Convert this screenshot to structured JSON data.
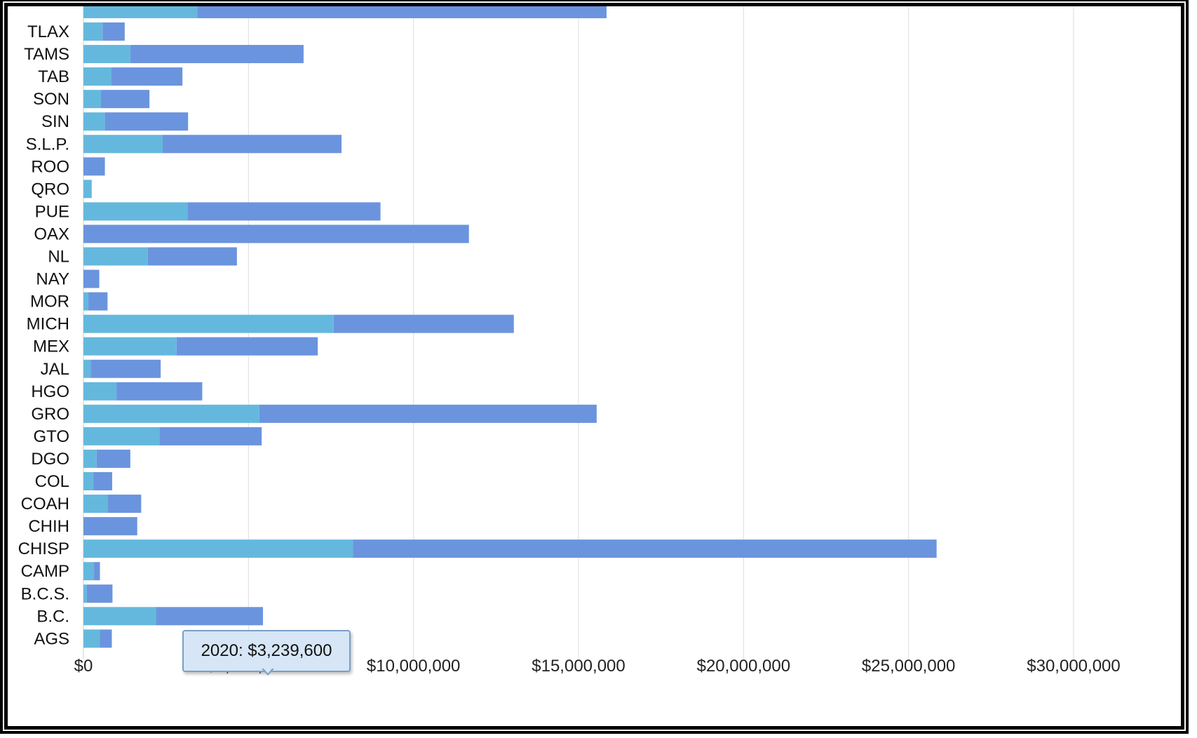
{
  "chart_data": {
    "type": "bar",
    "orientation": "horizontal",
    "stacked": true,
    "categories": [
      "TLAX",
      "TAMS",
      "TAB",
      "SON",
      "SIN",
      "S.L.P.",
      "ROO",
      "QRO",
      "PUE",
      "OAX",
      "NL",
      "NAY",
      "MOR",
      "MICH",
      "MEX",
      "JAL",
      "HGO",
      "GRO",
      "GTO",
      "DGO",
      "COL",
      "COAH",
      "CHIH",
      "CHISP",
      "CAMP",
      "B.C.S.",
      "B.C.",
      "AGS"
    ],
    "partial_top_category_value": 15850000,
    "partial_top_segment_value": 3450000,
    "series": [
      {
        "values": [
          580000,
          1420000,
          850000,
          530000,
          650000,
          2400000,
          0,
          250000,
          3150000,
          0,
          1950000,
          0,
          150000,
          7580000,
          2820000,
          220000,
          1000000,
          5330000,
          2300000,
          400000,
          300000,
          730000,
          0,
          8170000,
          320000,
          100000,
          2200000,
          500000
        ],
        "color": "#65b8dd"
      },
      {
        "values": [
          670000,
          5250000,
          2150000,
          1470000,
          2520000,
          5420000,
          650000,
          0,
          5850000,
          11680000,
          2700000,
          480000,
          580000,
          5460000,
          4280000,
          2120000,
          2600000,
          10220000,
          3100000,
          1020000,
          570000,
          1020000,
          1630000,
          17680000,
          180000,
          780000,
          3239600,
          360000
        ],
        "color": "#6b94de"
      }
    ],
    "xlim": [
      0,
      30000000
    ],
    "xticks": [
      "$0",
      "$5,000,000",
      "$10,000,000",
      "$15,000,000",
      "$20,000,000",
      "$25,000,000",
      "$30,000,000"
    ],
    "tick_values": [
      0,
      5000000,
      10000000,
      15000000,
      20000000,
      25000000,
      30000000
    ],
    "grid": true,
    "legend": "none"
  },
  "tooltip": {
    "text": "2020: $3,239,600"
  }
}
